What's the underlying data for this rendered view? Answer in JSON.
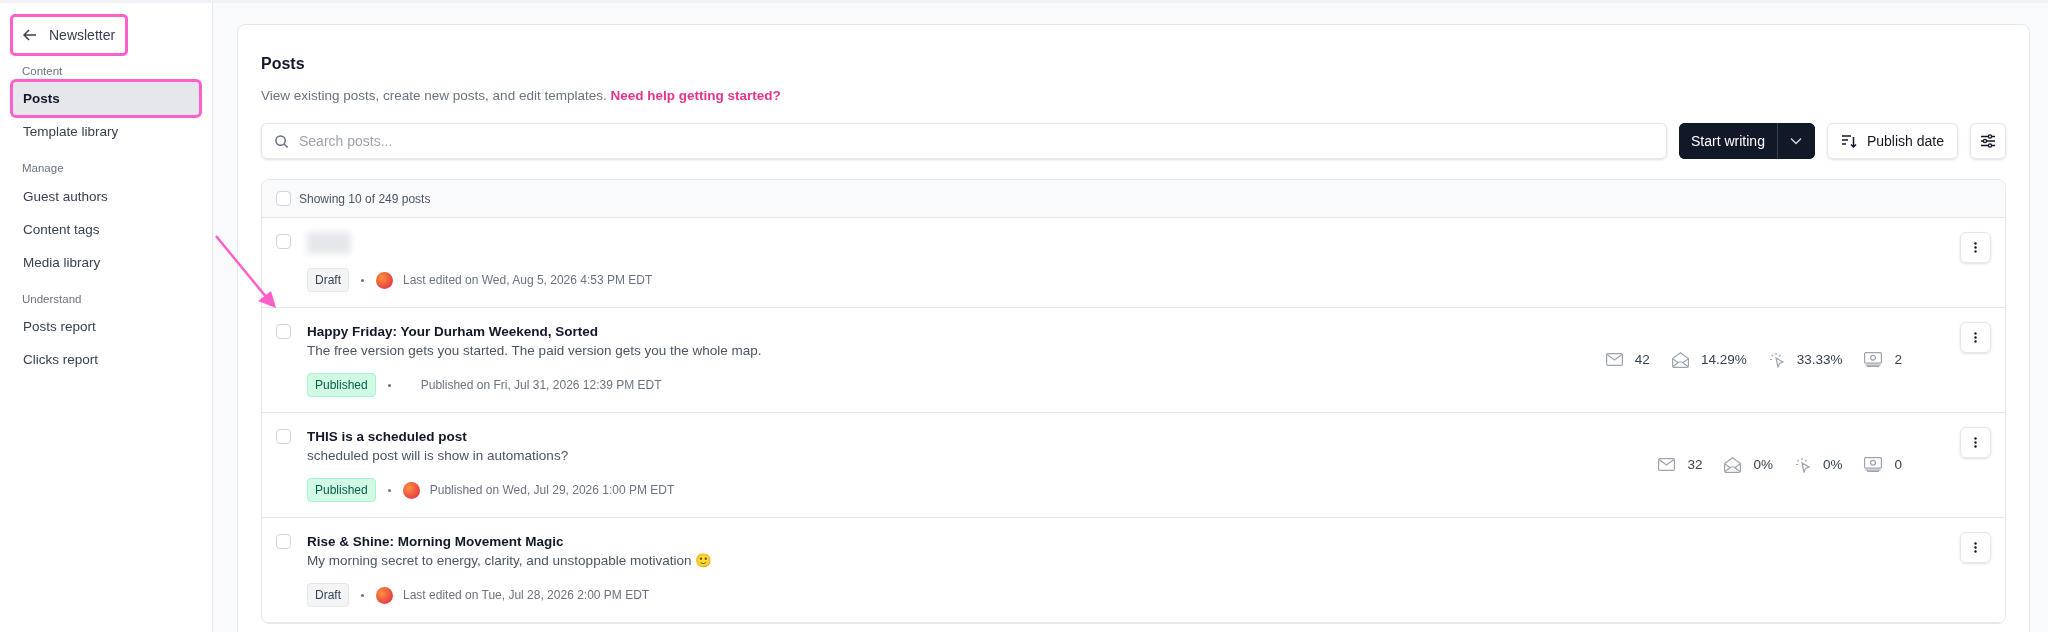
{
  "sidebar": {
    "back_link": {
      "label": "Newsletter",
      "highlighted": true
    },
    "sections": [
      {
        "heading": "Content",
        "items": [
          {
            "label": "Posts",
            "selected": true,
            "highlighted": true
          },
          {
            "label": "Template library",
            "selected": false,
            "highlighted": false
          }
        ]
      },
      {
        "heading": "Manage",
        "items": [
          {
            "label": "Guest authors",
            "selected": false,
            "highlighted": false
          },
          {
            "label": "Content tags",
            "selected": false,
            "highlighted": false
          },
          {
            "label": "Media library",
            "selected": false,
            "highlighted": false
          }
        ]
      },
      {
        "heading": "Understand",
        "items": [
          {
            "label": "Posts report",
            "selected": false,
            "highlighted": false
          },
          {
            "label": "Clicks report",
            "selected": false,
            "highlighted": false
          }
        ]
      }
    ]
  },
  "page": {
    "title": "Posts",
    "description": "View existing posts, create new posts, and edit templates.",
    "help_link": "Need help getting started?"
  },
  "toolbar": {
    "search": {
      "placeholder": "Search posts..."
    },
    "primary_button": "Start writing",
    "sort_button": "Publish date"
  },
  "list": {
    "annotation_arrow": true,
    "header": {
      "select_all_checked": false,
      "summary": "Showing 10 of 249 posts"
    },
    "rows": [
      {
        "title_blurred": true,
        "checked": false,
        "status": {
          "kind": "draft",
          "label": "Draft"
        },
        "avatar": true,
        "meta": "Last edited on Wed, Aug 5, 2026 4:53 PM EDT",
        "stats": []
      },
      {
        "title": "Happy Friday: Your Durham Weekend, Sorted",
        "subtitle": "The free version gets you started. The paid version gets you the whole map.",
        "checked": false,
        "status": {
          "kind": "published",
          "label": "Published"
        },
        "avatar": false,
        "meta": "Published on Fri, Jul 31, 2026 12:39 PM EDT",
        "stats": [
          {
            "kind": "sent",
            "value": "42"
          },
          {
            "kind": "opens",
            "value": "14.29%"
          },
          {
            "kind": "clicks",
            "value": "33.33%"
          },
          {
            "kind": "earnings",
            "value": "2"
          }
        ]
      },
      {
        "title": "THIS is a scheduled post",
        "subtitle": "scheduled post will is show in automations?",
        "checked": false,
        "status": {
          "kind": "published",
          "label": "Published"
        },
        "avatar": true,
        "meta": "Published on Wed, Jul 29, 2026 1:00 PM EDT",
        "stats": [
          {
            "kind": "sent",
            "value": "32"
          },
          {
            "kind": "opens",
            "value": "0%"
          },
          {
            "kind": "clicks",
            "value": "0%"
          },
          {
            "kind": "earnings",
            "value": "0"
          }
        ]
      },
      {
        "title": "Rise & Shine: Morning Movement Magic",
        "subtitle": "My morning secret to energy, clarity, and unstoppable motivation 🙂",
        "checked": false,
        "status": {
          "kind": "draft",
          "label": "Draft"
        },
        "avatar": true,
        "meta": "Last edited on Tue, Jul 28, 2026 2:00 PM EDT",
        "stats": []
      }
    ]
  }
}
